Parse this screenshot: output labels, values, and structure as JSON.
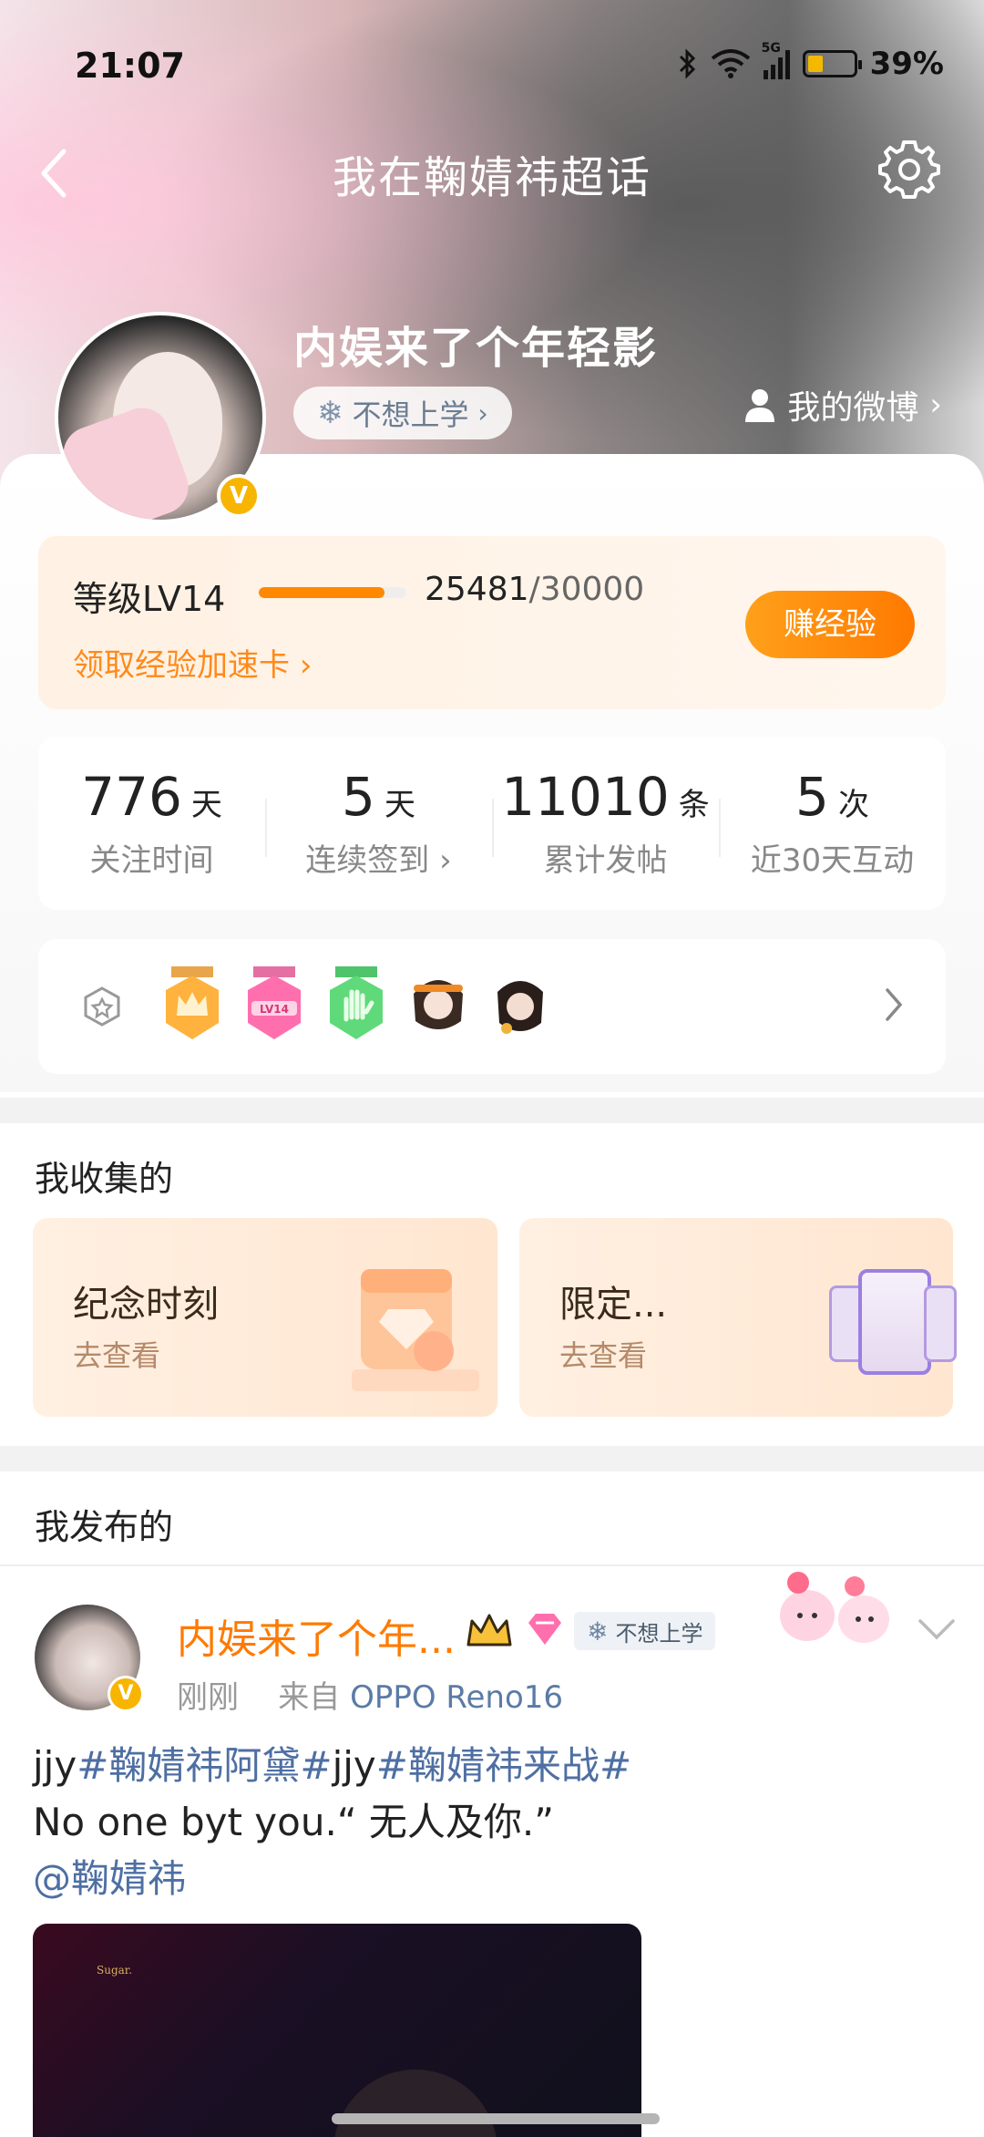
{
  "status_bar": {
    "time": "21:07",
    "network": "5G",
    "battery_percent": "39%",
    "battery_level": 0.39
  },
  "nav": {
    "title": "我在鞠婧祎超话",
    "back_icon": "chevron-left-icon",
    "settings_icon": "gear-icon"
  },
  "profile": {
    "username": "内娱来了个年轻影",
    "fan_tag": "不想上学",
    "my_weibo": "我的微博",
    "verified_badge": "V"
  },
  "level": {
    "label": "等级LV14",
    "exp_current": "25481",
    "exp_total": "/30000",
    "progress": 0.849,
    "accel_link": "领取经验加速卡",
    "earn_button": "赚经验"
  },
  "stats": [
    {
      "value": "776",
      "unit": "天",
      "label": "关注时间"
    },
    {
      "value": "5",
      "unit": "天",
      "label": "连续签到"
    },
    {
      "value": "11010",
      "unit": "条",
      "label": "累计发帖"
    },
    {
      "value": "5",
      "unit": "次",
      "label": "近30天互动"
    }
  ],
  "badges": {
    "lead_icon": "badge-outline-icon",
    "items": [
      "crown-medal",
      "lv14-medal",
      "hand-medal",
      "character-medal-1",
      "character-medal-2"
    ],
    "lv_badge_text": "LV14",
    "arrow_icon": "chevron-right-icon"
  },
  "collected": {
    "title": "我收集的",
    "cards": [
      {
        "title": "纪念时刻",
        "sub": "去查看"
      },
      {
        "title": "限定...",
        "sub": "去查看"
      }
    ]
  },
  "published": {
    "title": "我发布的",
    "post": {
      "name": "内娱来了个年...",
      "fan_tag": "不想上学",
      "time": "刚刚",
      "from": "来自",
      "device": "OPPO Reno16",
      "text_parts": [
        "jjy",
        "#鞠婧祎阿黛#",
        "jjy",
        "#鞠婧祎来战#"
      ],
      "line2": "No one byt you.“ 无人及你.”",
      "mention": "@鞠婧祎",
      "image_caption": "Sugar."
    }
  },
  "colors": {
    "accent_orange": "#ff8800",
    "link_blue": "#4e6fa3",
    "vip_gold": "#f7b500"
  }
}
